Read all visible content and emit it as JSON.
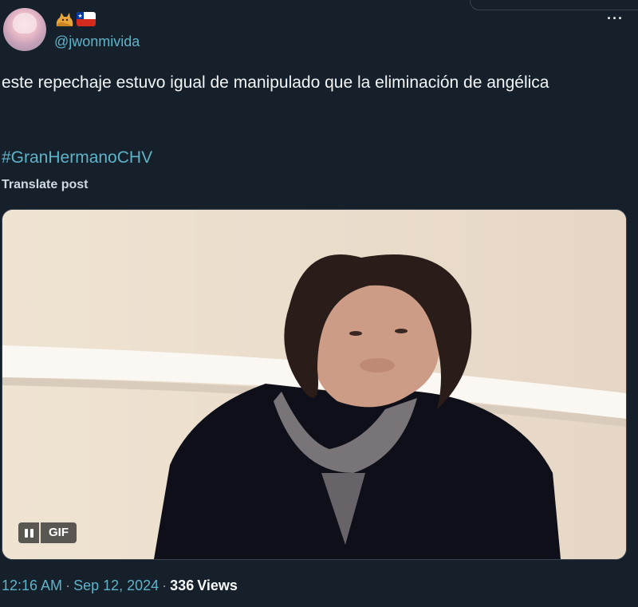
{
  "author": {
    "handle": "@jwonmivida",
    "emoji": [
      "cat-emoji",
      "chile-flag-emoji"
    ]
  },
  "post": {
    "text": "este repechaje estuvo igual de manipulado que la eliminación de angélica",
    "hashtag": "#GranHermanoCHV",
    "translate_label": "Translate post"
  },
  "media": {
    "badge": "GIF",
    "pause_icon": "pause-icon"
  },
  "meta": {
    "time": "12:16 AM",
    "date": "Sep 12, 2024",
    "separator": "·",
    "views_count": "336",
    "views_label": "Views"
  },
  "more_icon": "more-icon",
  "colors": {
    "background": "#15202b",
    "link": "#5eb3c9",
    "text": "#f2f4f5"
  }
}
